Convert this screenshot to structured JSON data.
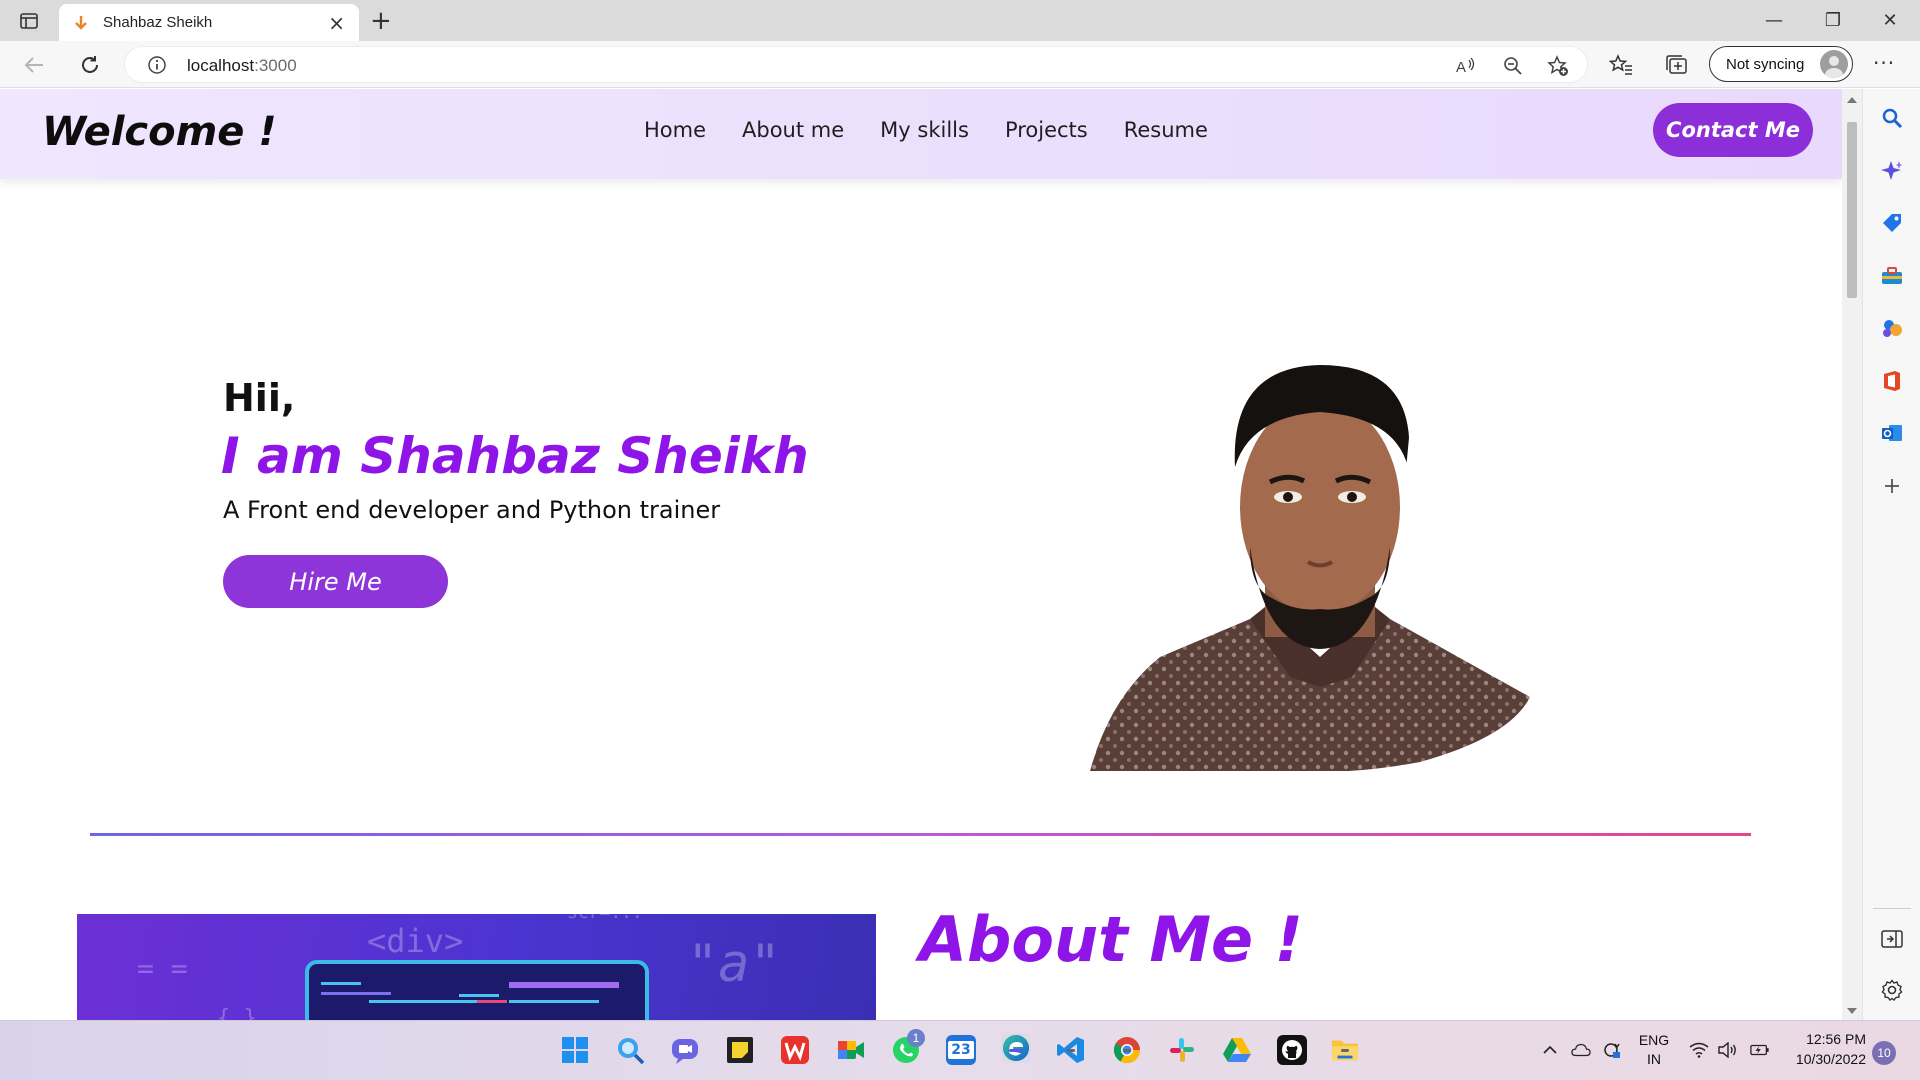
{
  "browser": {
    "tab_title": "Shahbaz Sheikh",
    "tab_close": "×",
    "new_tab": "+",
    "url_host": "localhost",
    "url_port": ":3000",
    "sync_label": "Not syncing",
    "more_label": "···",
    "minimize": "—",
    "restore": "❐",
    "close": "✕"
  },
  "site": {
    "brand": "Welcome !",
    "nav": [
      "Home",
      "About me",
      "My skills",
      "Projects",
      "Resume"
    ],
    "contact_button": "Contact Me",
    "hero": {
      "greeting": "Hii,",
      "name": "I am Shahbaz Sheikh",
      "tagline": "A Front end developer and Python trainer",
      "hire_button": "Hire Me"
    },
    "about": {
      "title": "About Me !",
      "image_code_texts": [
        "<div>",
        "= =",
        "{ }",
        "scr=...",
        "\"a\""
      ]
    }
  },
  "taskbar": {
    "icons": [
      "windows-start",
      "search",
      "chat",
      "sticky-notes",
      "wps-office",
      "google-meet",
      "whatsapp",
      "calendar",
      "edge",
      "vscode",
      "chrome",
      "slack",
      "google-drive",
      "github",
      "file-explorer"
    ],
    "whatsapp_badge": "1",
    "calendar_day": "23",
    "language_top": "ENG",
    "language_bottom": "IN",
    "time": "12:56 PM",
    "date": "10/30/2022",
    "notification_count": "10"
  },
  "colors": {
    "accent_purple": "#8f14e8",
    "button_purple": "#8c2fd8",
    "nav_bg": "#efe4fd"
  }
}
